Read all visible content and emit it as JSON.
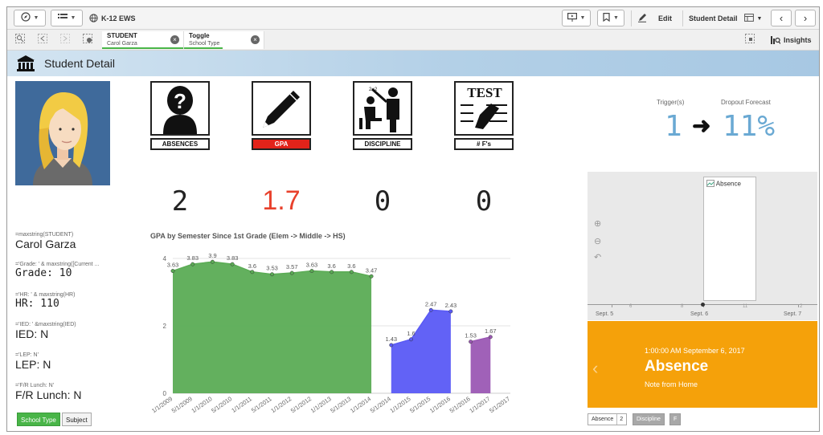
{
  "toolbar": {
    "app_name": "K-12 EWS",
    "edit_label": "Edit",
    "sheet_name": "Student Detail",
    "icons": {
      "compass": "compass-icon",
      "list": "list-icon",
      "globe": "globe-icon",
      "present": "presentation-icon",
      "bookmark": "bookmark-icon",
      "pencil": "pencil-icon",
      "sheet": "sheet-icon",
      "prev": "chevron-left-icon",
      "next": "chevron-right-icon"
    }
  },
  "selections": {
    "chips": [
      {
        "key": "STUDENT",
        "value": "Carol Garza"
      },
      {
        "key": "Toggle",
        "value": "School Type"
      }
    ],
    "insights_label": "Insights"
  },
  "page": {
    "title": "Student Detail"
  },
  "kpis": [
    {
      "label": "ABSENCES",
      "value": "2",
      "icon": "absences-icon",
      "highlight": false
    },
    {
      "label": "GPA",
      "value": "1.7",
      "icon": "gpa-icon",
      "highlight": true
    },
    {
      "label": "DISCIPLINE",
      "value": "0",
      "icon": "discipline-icon",
      "highlight": false
    },
    {
      "label": "# F's",
      "value": "0",
      "icon": "test-icon",
      "highlight": false
    }
  ],
  "kpi_icon_texts": {
    "test": "TEST"
  },
  "fields": [
    {
      "expr": "=maxstring(STUDENT)",
      "value": "Carol Garza"
    },
    {
      "expr": "='Grade: ' & maxstring([Current ...",
      "value": "Grade: 10"
    },
    {
      "expr": "='HR: ' & maxstring(HR)",
      "value": "HR: 110"
    },
    {
      "expr": "='IED: ' &maxstring(IED)",
      "value": "IED: N"
    },
    {
      "expr": "='LEP: N'",
      "value": "LEP: N"
    },
    {
      "expr": "='F/R Lunch: N'",
      "value": "F/R Lunch: N"
    }
  ],
  "buttons": {
    "school_type": "School Type",
    "subject": "Subject"
  },
  "trigger": {
    "triggers_label": "Trigger(s)",
    "triggers_value": "1",
    "forecast_label": "Dropout Forecast",
    "forecast_value": "11%"
  },
  "timeline": {
    "card_label": "Absence",
    "dates": [
      "Sept. 5",
      "Sept. 6",
      "Sept. 7"
    ],
    "small_ticks": [
      "6",
      "8",
      "11",
      "2"
    ]
  },
  "event": {
    "time": "1:00:00 AM September 6, 2017",
    "name": "Absence",
    "note": "Note from Home"
  },
  "bottom_tabs": [
    {
      "label": "Absence",
      "count": "2"
    },
    {
      "label": "Discipline"
    },
    {
      "label": "F"
    }
  ],
  "chart_data": {
    "type": "area",
    "title": "GPA by Semester Since 1st Grade (Elem -> Middle -> HS)",
    "xlabel": "",
    "ylabel": "",
    "ylim": [
      0,
      4
    ],
    "yticks": [
      0,
      2,
      4
    ],
    "grid": true,
    "categories": [
      "1/1/2009",
      "5/1/2009",
      "1/1/2010",
      "5/1/2010",
      "1/1/2011",
      "5/1/2011",
      "1/1/2012",
      "5/1/2012",
      "1/1/2013",
      "5/1/2013",
      "1/1/2014",
      "5/1/2014",
      "1/1/2015",
      "5/1/2015",
      "1/1/2016",
      "5/1/2016",
      "1/1/2017",
      "5/1/2017"
    ],
    "series": [
      {
        "color": "#5bac55",
        "start": 0,
        "values": [
          3.63,
          3.83,
          3.9,
          3.83,
          3.6,
          3.53,
          3.57,
          3.63,
          3.6,
          3.6,
          3.47
        ]
      },
      {
        "color": "#5a5af5",
        "start": 11,
        "values": [
          1.43,
          1.6,
          2.47,
          2.43
        ]
      },
      {
        "color": "#9b58b4",
        "start": 15,
        "values": [
          1.53,
          1.67
        ]
      }
    ]
  }
}
